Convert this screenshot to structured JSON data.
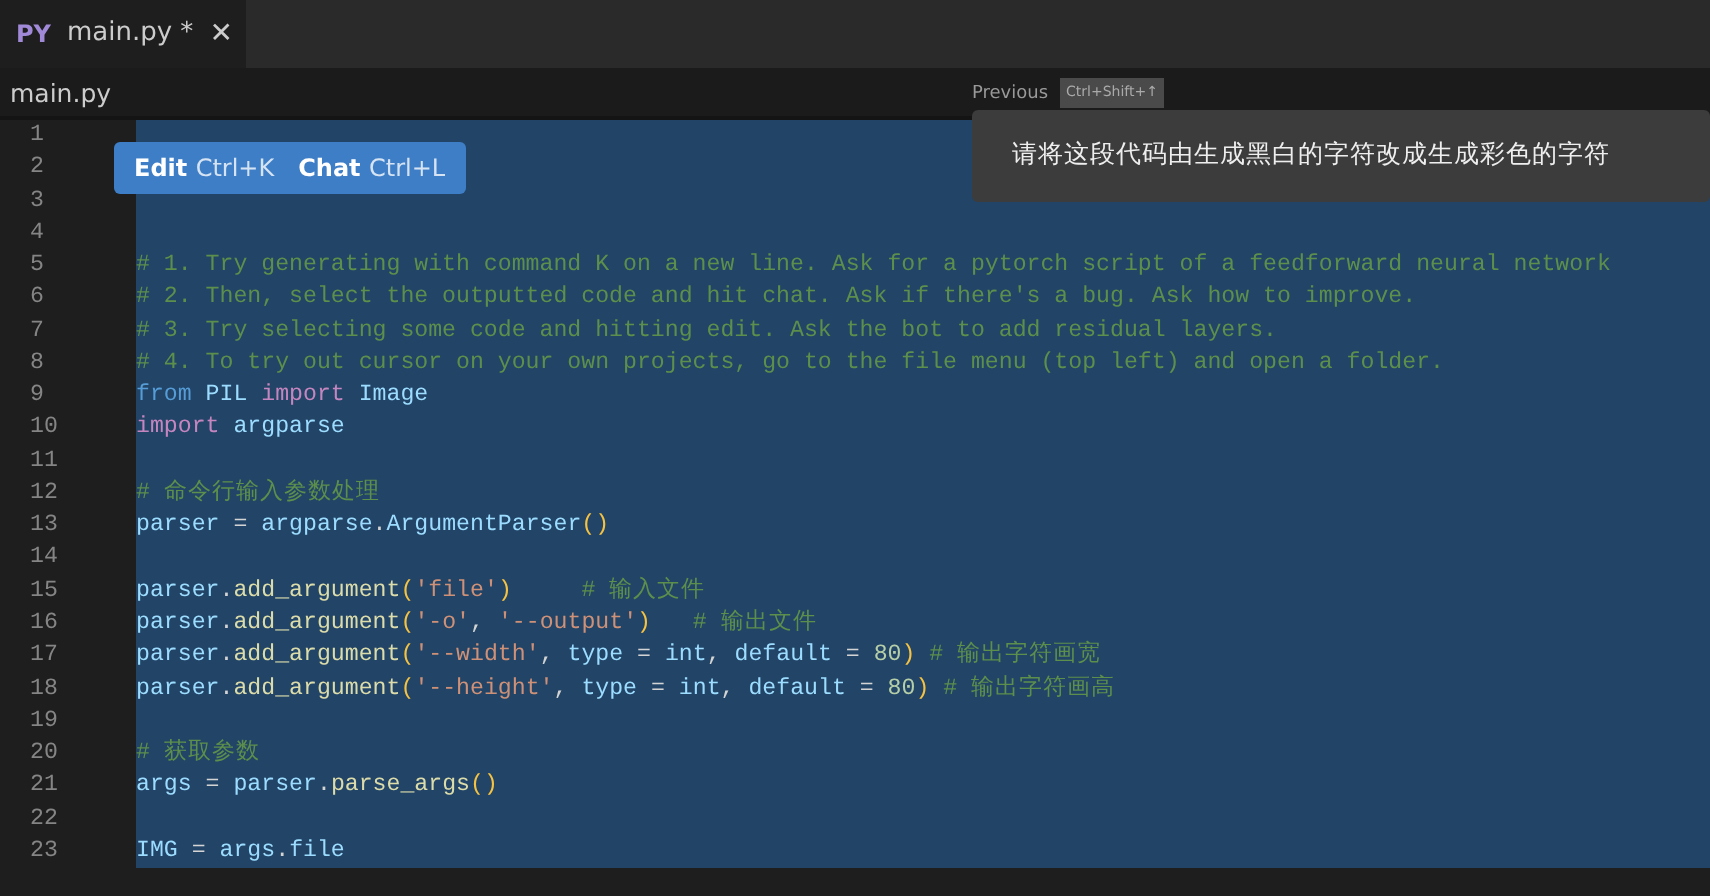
{
  "tab": {
    "icon_text": "PY",
    "title": "main.py *",
    "close": "✕",
    "selected": true
  },
  "breadcrumb": "main.py",
  "navigation": {
    "label": "Previous",
    "shortcut": "Ctrl+Shift+↑"
  },
  "prompt": {
    "text": "请将这段代码由生成黑白的字符改成生成彩色的字符"
  },
  "selection_popup": {
    "buttons": [
      {
        "label": "Edit",
        "shortcut": "Ctrl+K"
      },
      {
        "label": "Chat",
        "shortcut": "Ctrl+L"
      }
    ]
  },
  "lines": [
    {
      "number": "1",
      "selected": true
    },
    {
      "number": "2",
      "selected": true
    },
    {
      "number": "3",
      "selected": true
    },
    {
      "number": "4",
      "selected": true
    },
    {
      "number": "5",
      "selected": true,
      "tokens": [
        {
          "kind": "comment",
          "text": "# 1. Try generating with command K on a new line. Ask for a pytorch script of a feedforward neural network"
        }
      ]
    },
    {
      "number": "6",
      "selected": true,
      "tokens": [
        {
          "kind": "comment",
          "text": "# 2. Then, select the outputted code and hit chat. Ask if there's a bug. Ask how to improve."
        }
      ]
    },
    {
      "number": "7",
      "selected": true,
      "tokens": [
        {
          "kind": "comment",
          "text": "# 3. Try selecting some code and hitting edit. Ask the bot to add residual layers."
        }
      ]
    },
    {
      "number": "8",
      "selected": true,
      "tokens": [
        {
          "kind": "comment",
          "text": "# 4. To try out cursor on your own projects, go to the file menu (top left) and open a folder."
        }
      ]
    },
    {
      "number": "9",
      "selected": true,
      "tokens": [
        {
          "kind": "keyword",
          "text": "from"
        },
        {
          "kind": "name",
          "text": " PIL"
        },
        {
          "kind": "import",
          "text": " import"
        },
        {
          "kind": "name",
          "text": " Image"
        }
      ]
    },
    {
      "number": "10",
      "selected": true,
      "tokens": [
        {
          "kind": "import",
          "text": "import"
        },
        {
          "kind": "name",
          "text": " argparse"
        }
      ]
    },
    {
      "number": "11",
      "selected": true
    },
    {
      "number": "12",
      "selected": true,
      "tokens": [
        {
          "kind": "comment",
          "text": "# 命令行输入参数处理"
        }
      ]
    },
    {
      "number": "13",
      "selected": true,
      "tokens": [
        {
          "kind": "name",
          "text": "parser"
        },
        {
          "kind": "plain",
          "text": " = "
        },
        {
          "kind": "name",
          "text": "argparse"
        },
        {
          "kind": "plain",
          "text": "."
        },
        {
          "kind": "name",
          "text": "ArgumentParser"
        },
        {
          "kind": "paren",
          "text": "()"
        }
      ]
    },
    {
      "number": "14",
      "selected": true
    },
    {
      "number": "15",
      "selected": true,
      "tokens": [
        {
          "kind": "name",
          "text": "parser"
        },
        {
          "kind": "plain",
          "text": "."
        },
        {
          "kind": "func",
          "text": "add_argument"
        },
        {
          "kind": "paren",
          "text": "("
        },
        {
          "kind": "string",
          "text": "'file'"
        },
        {
          "kind": "paren",
          "text": ")"
        },
        {
          "kind": "comment",
          "text": "     # 输入文件"
        }
      ]
    },
    {
      "number": "16",
      "selected": true,
      "tokens": [
        {
          "kind": "name",
          "text": "parser"
        },
        {
          "kind": "plain",
          "text": "."
        },
        {
          "kind": "func",
          "text": "add_argument"
        },
        {
          "kind": "paren",
          "text": "("
        },
        {
          "kind": "string",
          "text": "'-o'"
        },
        {
          "kind": "plain",
          "text": ", "
        },
        {
          "kind": "string",
          "text": "'--output'"
        },
        {
          "kind": "paren",
          "text": ")"
        },
        {
          "kind": "comment",
          "text": "   # 输出文件"
        }
      ]
    },
    {
      "number": "17",
      "selected": true,
      "tokens": [
        {
          "kind": "name",
          "text": "parser"
        },
        {
          "kind": "plain",
          "text": "."
        },
        {
          "kind": "func",
          "text": "add_argument"
        },
        {
          "kind": "paren",
          "text": "("
        },
        {
          "kind": "string",
          "text": "'--width'"
        },
        {
          "kind": "plain",
          "text": ", "
        },
        {
          "kind": "name",
          "text": "type"
        },
        {
          "kind": "plain",
          "text": " = "
        },
        {
          "kind": "name",
          "text": "int"
        },
        {
          "kind": "plain",
          "text": ", "
        },
        {
          "kind": "name",
          "text": "default"
        },
        {
          "kind": "plain",
          "text": " = "
        },
        {
          "kind": "number",
          "text": "80"
        },
        {
          "kind": "paren",
          "text": ")"
        },
        {
          "kind": "comment",
          "text": " # 输出字符画宽"
        }
      ]
    },
    {
      "number": "18",
      "selected": true,
      "tokens": [
        {
          "kind": "name",
          "text": "parser"
        },
        {
          "kind": "plain",
          "text": "."
        },
        {
          "kind": "func",
          "text": "add_argument"
        },
        {
          "kind": "paren",
          "text": "("
        },
        {
          "kind": "string",
          "text": "'--height'"
        },
        {
          "kind": "plain",
          "text": ", "
        },
        {
          "kind": "name",
          "text": "type"
        },
        {
          "kind": "plain",
          "text": " = "
        },
        {
          "kind": "name",
          "text": "int"
        },
        {
          "kind": "plain",
          "text": ", "
        },
        {
          "kind": "name",
          "text": "default"
        },
        {
          "kind": "plain",
          "text": " = "
        },
        {
          "kind": "number",
          "text": "80"
        },
        {
          "kind": "paren",
          "text": ")"
        },
        {
          "kind": "comment",
          "text": " # 输出字符画高"
        }
      ]
    },
    {
      "number": "19",
      "selected": true
    },
    {
      "number": "20",
      "selected": true,
      "tokens": [
        {
          "kind": "comment",
          "text": "# 获取参数"
        }
      ]
    },
    {
      "number": "21",
      "selected": true,
      "tokens": [
        {
          "kind": "name",
          "text": "args"
        },
        {
          "kind": "plain",
          "text": " = "
        },
        {
          "kind": "name",
          "text": "parser"
        },
        {
          "kind": "plain",
          "text": "."
        },
        {
          "kind": "func",
          "text": "parse_args"
        },
        {
          "kind": "paren",
          "text": "()"
        }
      ]
    },
    {
      "number": "22",
      "selected": true
    },
    {
      "number": "23",
      "selected": true,
      "tokens": [
        {
          "kind": "name",
          "text": "IMG"
        },
        {
          "kind": "plain",
          "text": " = "
        },
        {
          "kind": "name",
          "text": "args"
        },
        {
          "kind": "plain",
          "text": "."
        },
        {
          "kind": "name",
          "text": "file"
        }
      ]
    }
  ]
}
